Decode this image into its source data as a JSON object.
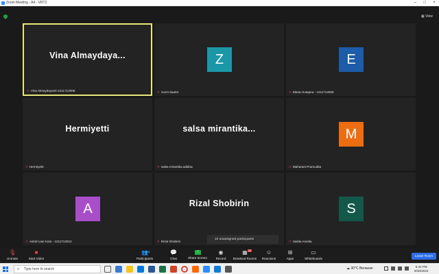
{
  "window": {
    "title": "Zoom Meeting - A4 - VRT2",
    "view_label": "View"
  },
  "tiles": [
    {
      "display": "Vina Almaydaya...",
      "label": "Vina Almaydayanti-1211712009",
      "type": "name",
      "active": true
    },
    {
      "display": "Z",
      "label": "zoom baa04",
      "type": "avatar",
      "color": "#1c97a8"
    },
    {
      "display": "E",
      "label": "Elena Hutapea - 1211712006",
      "type": "avatar",
      "color": "#1c5ca8"
    },
    {
      "display": "Hermiyetti",
      "label": "Hermiyetti",
      "type": "name"
    },
    {
      "display": "salsa  mirantika...",
      "label": "salsa mirantika adidna",
      "type": "name"
    },
    {
      "display": "M",
      "label": "Maharani Pramudita",
      "type": "avatar",
      "color": "#ec6d12"
    },
    {
      "display": "A",
      "label": "Astrid Lian Koto - 1211712012",
      "type": "avatar",
      "color": "#a84ec9"
    },
    {
      "display": "Rizal Shobirin",
      "label": "Rizal Shobirin",
      "type": "name"
    },
    {
      "display": "S",
      "label": "Sakila Amelia",
      "type": "avatar",
      "color": "#14584a"
    }
  ],
  "unassigned": "10 unassigned participants",
  "toolbar": {
    "unmute": "Unmute",
    "start_video": "Start Video",
    "participants": "Participants",
    "participants_count": "9",
    "chat": "Chat",
    "share_screen": "Share Screen",
    "record": "Record",
    "breakout_rooms": "Breakout Rooms",
    "breakout_badge": "10",
    "reactions": "Reactions",
    "apps": "Apps",
    "whiteboards": "Whiteboards",
    "leave": "Leave Room"
  },
  "taskbar": {
    "search_placeholder": "Type here to search",
    "weather": "30°C  Berawan",
    "time": "6:42 PM",
    "date": "9/30/2022"
  },
  "colors": {
    "active_border": "#e8e87a",
    "leave_button": "#2d6eea",
    "share_green": "#1fb141",
    "mic_muted": "#e04545"
  }
}
